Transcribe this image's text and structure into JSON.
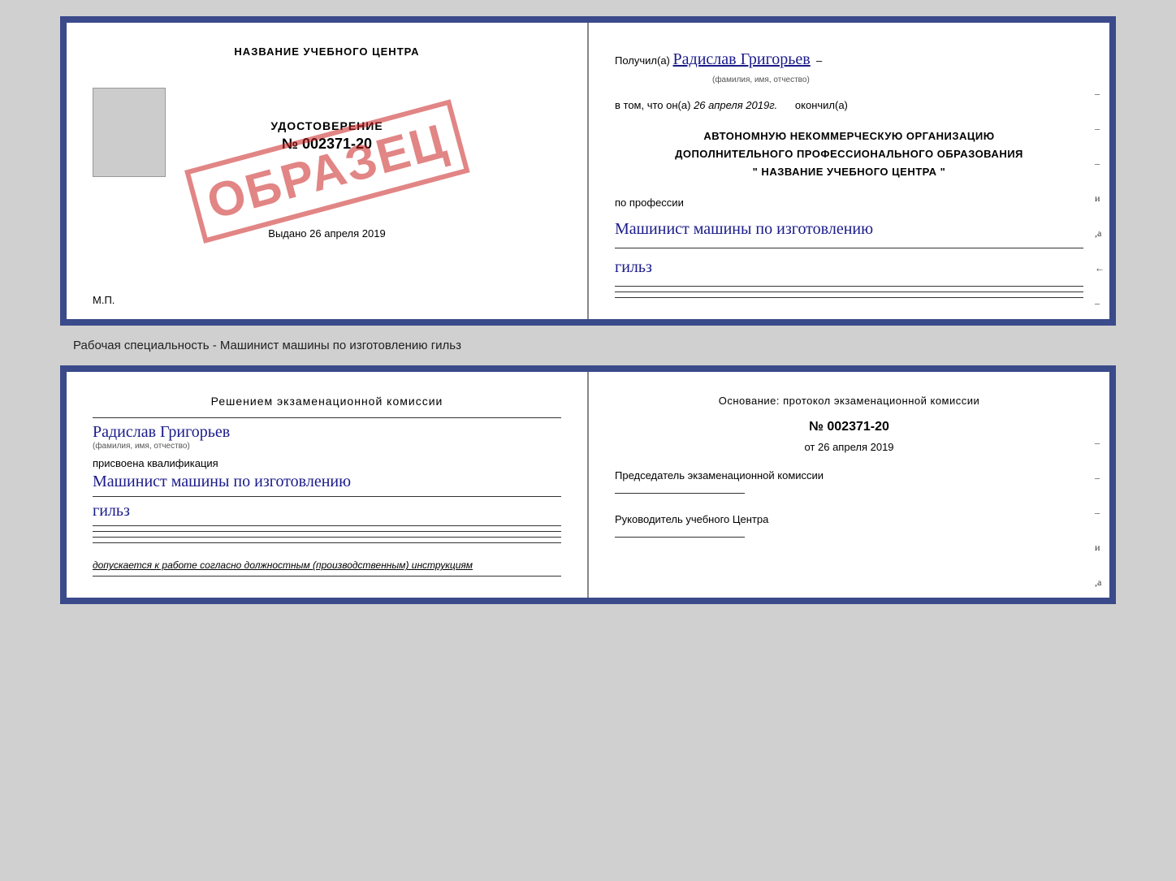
{
  "top_document": {
    "left": {
      "training_center": "НАЗВАНИЕ УЧЕБНОГО ЦЕНТРА",
      "stamp": "ОБРАЗЕЦ",
      "certificate_label": "УДОСТОВЕРЕНИЕ",
      "certificate_number": "№ 002371-20",
      "issued_label": "Выдано",
      "issued_date": "26 апреля 2019",
      "mp_label": "М.П."
    },
    "right": {
      "received_prefix": "Получил(а)",
      "person_name": "Радислав Григорьев",
      "name_caption": "(фамилия, имя, отчество)",
      "date_prefix": "в том, что он(а)",
      "date_value": "26 апреля 2019г.",
      "date_suffix": "окончил(а)",
      "org_line1": "АВТОНОМНУЮ НЕКОММЕРЧЕСКУЮ ОРГАНИЗАЦИЮ",
      "org_line2": "ДОПОЛНИТЕЛЬНОГО ПРОФЕССИОНАЛЬНОГО ОБРАЗОВАНИЯ",
      "org_line3": "\" НАЗВАНИЕ УЧЕБНОГО ЦЕНТРА \"",
      "profession_label": "по профессии",
      "profession_value": "Машинист машины по изготовлению",
      "profession_value2": "гильз",
      "side_marks": [
        "-",
        "-",
        "-",
        "и",
        ",а",
        "←",
        "-",
        "-",
        "-"
      ]
    }
  },
  "caption": "Рабочая специальность - Машинист машины по изготовлению гильз",
  "bottom_document": {
    "left": {
      "commission_title": "Решением  экзаменационной  комиссии",
      "person_name": "Радислав Григорьев",
      "name_caption": "(фамилия, имя, отчество)",
      "assigned_label": "присвоена квалификация",
      "qualification_value": "Машинист машины по изготовлению",
      "qualification_value2": "гильз",
      "allowed_text": "допускается к  работе согласно должностным (производственным) инструкциям"
    },
    "right": {
      "basis_title": "Основание: протокол экзаменационной комиссии",
      "protocol_number": "№  002371-20",
      "protocol_date_prefix": "от",
      "protocol_date": "26 апреля 2019",
      "chairman_title": "Председатель экзаменационной комиссии",
      "director_title": "Руководитель учебного Центра",
      "side_marks": [
        "-",
        "-",
        "-",
        "и",
        ",а",
        "←",
        "-",
        "-",
        "-"
      ]
    }
  }
}
